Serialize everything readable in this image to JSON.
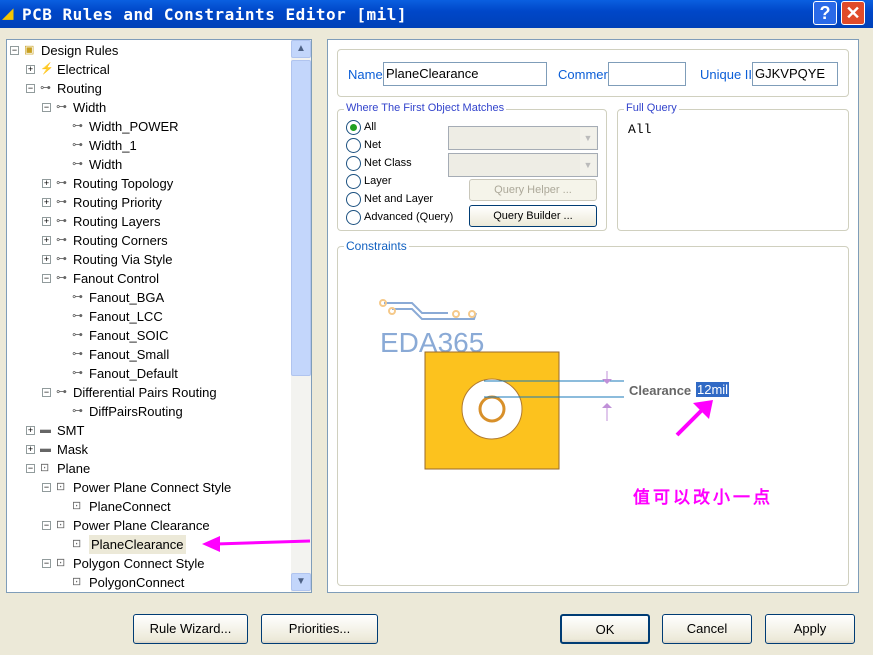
{
  "window": {
    "title": "PCB Rules and Constraints Editor [mil]",
    "help": "?",
    "close": "✕"
  },
  "tree": [
    {
      "label": "Design Rules",
      "level": 0,
      "exp": "-",
      "icon": "folder"
    },
    {
      "label": "Electrical",
      "level": 1,
      "exp": "+",
      "icon": "electrical"
    },
    {
      "label": "Routing",
      "level": 1,
      "exp": "-",
      "icon": "rule"
    },
    {
      "label": "Width",
      "level": 2,
      "exp": "-",
      "icon": "rule"
    },
    {
      "label": "Width_POWER",
      "level": 3,
      "icon": "rule"
    },
    {
      "label": "Width_1",
      "level": 3,
      "icon": "rule"
    },
    {
      "label": "Width",
      "level": 3,
      "icon": "rule"
    },
    {
      "label": "Routing Topology",
      "level": 2,
      "exp": "+",
      "icon": "rule"
    },
    {
      "label": "Routing Priority",
      "level": 2,
      "exp": "+",
      "icon": "rule"
    },
    {
      "label": "Routing Layers",
      "level": 2,
      "exp": "+",
      "icon": "rule"
    },
    {
      "label": "Routing Corners",
      "level": 2,
      "exp": "+",
      "icon": "rule"
    },
    {
      "label": "Routing Via Style",
      "level": 2,
      "exp": "+",
      "icon": "rule"
    },
    {
      "label": "Fanout Control",
      "level": 2,
      "exp": "-",
      "icon": "rule"
    },
    {
      "label": "Fanout_BGA",
      "level": 3,
      "icon": "rule"
    },
    {
      "label": "Fanout_LCC",
      "level": 3,
      "icon": "rule"
    },
    {
      "label": "Fanout_SOIC",
      "level": 3,
      "icon": "rule"
    },
    {
      "label": "Fanout_Small",
      "level": 3,
      "icon": "rule"
    },
    {
      "label": "Fanout_Default",
      "level": 3,
      "icon": "rule"
    },
    {
      "label": "Differential Pairs Routing",
      "level": 2,
      "exp": "-",
      "icon": "rule"
    },
    {
      "label": "DiffPairsRouting",
      "level": 3,
      "icon": "rule"
    },
    {
      "label": "SMT",
      "level": 1,
      "exp": "+",
      "icon": "smt"
    },
    {
      "label": "Mask",
      "level": 1,
      "exp": "+",
      "icon": "mask"
    },
    {
      "label": "Plane",
      "level": 1,
      "exp": "-",
      "icon": "plane"
    },
    {
      "label": "Power Plane Connect Style",
      "level": 2,
      "exp": "-",
      "icon": "plane"
    },
    {
      "label": "PlaneConnect",
      "level": 3,
      "icon": "plane"
    },
    {
      "label": "Power Plane Clearance",
      "level": 2,
      "exp": "-",
      "icon": "plane"
    },
    {
      "label": "PlaneClearance",
      "level": 3,
      "icon": "plane",
      "selected": true
    },
    {
      "label": "Polygon Connect Style",
      "level": 2,
      "exp": "-",
      "icon": "plane"
    },
    {
      "label": "PolygonConnect",
      "level": 3,
      "icon": "plane"
    }
  ],
  "header": {
    "name_label": "Name",
    "name_value": "PlaneClearance",
    "comment_label": "Commer",
    "comment_value": "",
    "uid_label": "Unique II",
    "uid_value": "GJKVPQYE"
  },
  "where": {
    "title": "Where The First Object Matches",
    "options": [
      "All",
      "Net",
      "Net Class",
      "Layer",
      "Net and Layer",
      "Advanced (Query)"
    ],
    "selected": 0,
    "query_helper": "Query Helper ...",
    "query_builder": "Query Builder ..."
  },
  "full_query": {
    "title": "Full Query",
    "value": "All"
  },
  "constraints": {
    "title": "Constraints",
    "logo": "EDA365",
    "clearance_label": "Clearance",
    "clearance_value": "12mil",
    "annotation": "值可以改小一点",
    "arrow_color": "#ff00ff"
  },
  "buttons": {
    "rule_wizard": "Rule Wizard...",
    "priorities": "Priorities...",
    "ok": "OK",
    "cancel": "Cancel",
    "apply": "Apply"
  }
}
